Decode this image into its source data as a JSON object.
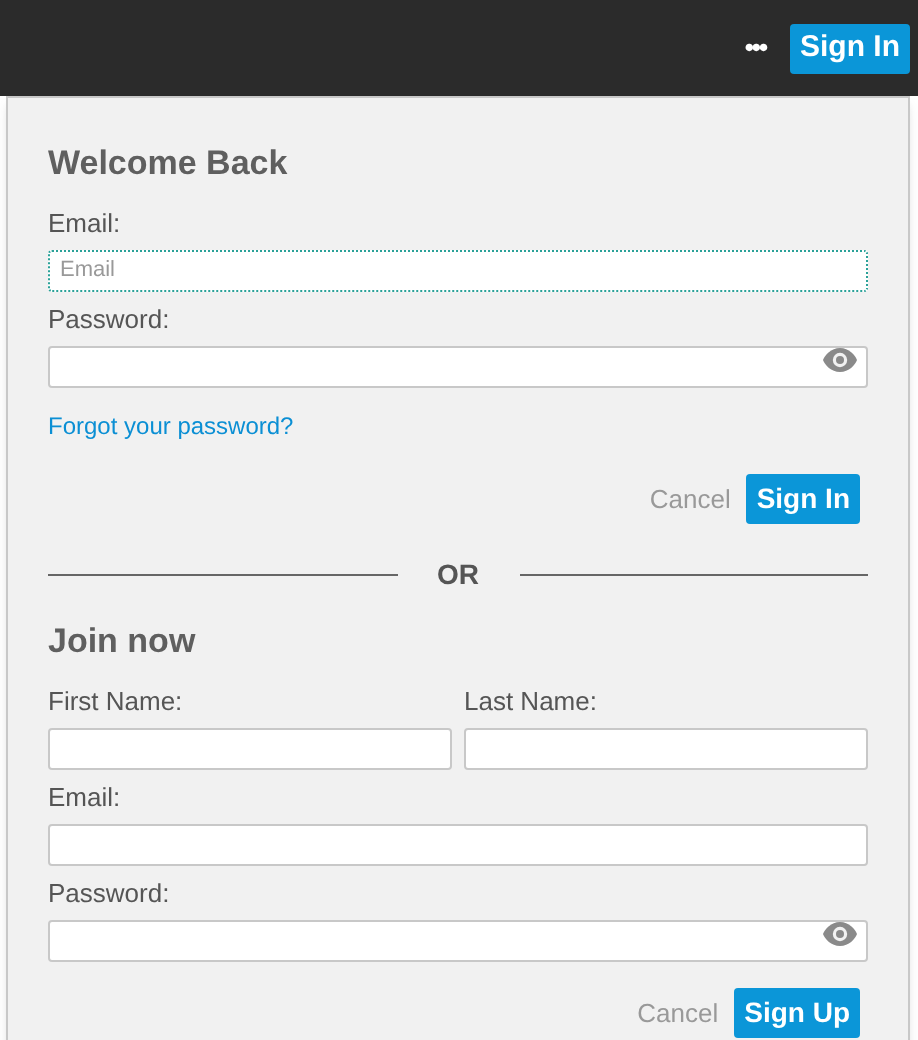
{
  "top_bar": {
    "more_label": "•••",
    "sign_in": "Sign In"
  },
  "sign_in_form": {
    "title": "Welcome Back",
    "fields": [
      {
        "label": "Email:",
        "placeholder": "Email",
        "kind": "text",
        "focused": true
      },
      {
        "label": "Password:",
        "kind": "password",
        "focused": false
      }
    ],
    "forgot_link": "Forgot your password?",
    "cancel": "Cancel",
    "submit": "Sign In"
  },
  "divider": "OR",
  "join_form": {
    "title": "Join now",
    "name_fields": [
      {
        "label": "First Name:",
        "focused": false
      },
      {
        "label": "Last Name:",
        "focused": false
      }
    ],
    "fields": [
      {
        "label": "Email:",
        "kind": "text",
        "focused": false
      },
      {
        "label": "Password:",
        "kind": "password",
        "focused": false
      }
    ],
    "cancel": "Cancel",
    "submit": "Sign Up"
  }
}
